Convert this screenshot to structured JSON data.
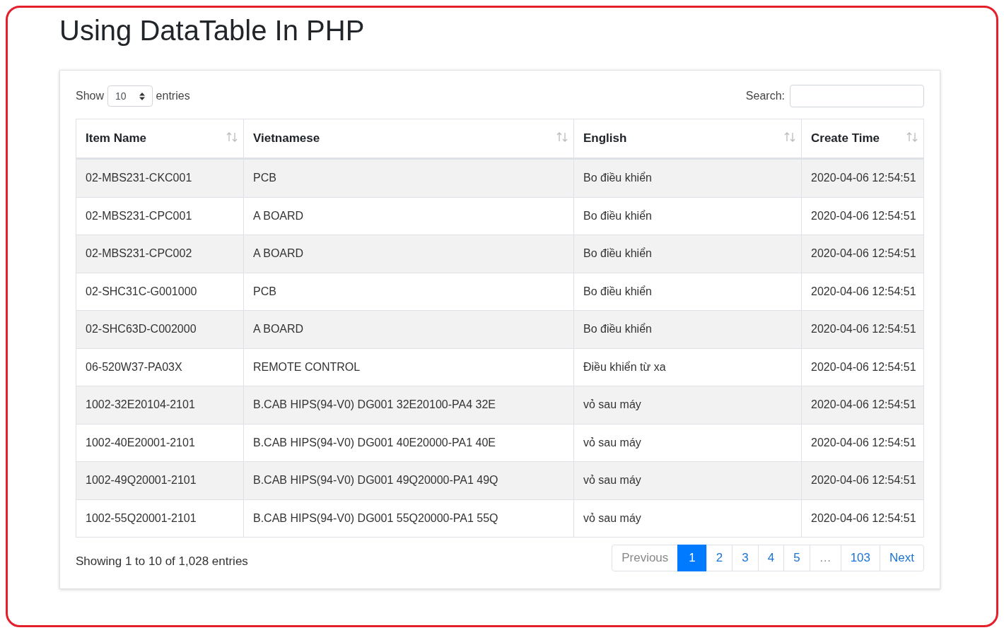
{
  "title": "Using DataTable In PHP",
  "length_menu": {
    "before": "Show",
    "value": "10",
    "after": "entries"
  },
  "search": {
    "label": "Search:"
  },
  "table": {
    "columns": [
      "Item Name",
      "Vietnamese",
      "English",
      "Create Time"
    ],
    "rows": [
      [
        "02-MBS231-CKC001",
        "PCB",
        "Bo điều khiển",
        "2020-04-06 12:54:51"
      ],
      [
        "02-MBS231-CPC001",
        "A BOARD",
        "Bo điều khiển",
        "2020-04-06 12:54:51"
      ],
      [
        "02-MBS231-CPC002",
        "A BOARD",
        "Bo điều khiển",
        "2020-04-06 12:54:51"
      ],
      [
        "02-SHC31C-G001000",
        "PCB",
        "Bo điều khiển",
        "2020-04-06 12:54:51"
      ],
      [
        "02-SHC63D-C002000",
        "A BOARD",
        "Bo điều khiển",
        "2020-04-06 12:54:51"
      ],
      [
        "06-520W37-PA03X",
        "REMOTE CONTROL",
        "Điều khiển từ xa",
        "2020-04-06 12:54:51"
      ],
      [
        "1002-32E20104-2101",
        "B.CAB HIPS(94-V0) DG001 32E20100-PA4 32E",
        "vỏ sau máy",
        "2020-04-06 12:54:51"
      ],
      [
        "1002-40E20001-2101",
        "B.CAB HIPS(94-V0) DG001 40E20000-PA1 40E",
        "vỏ sau máy",
        "2020-04-06 12:54:51"
      ],
      [
        "1002-49Q20001-2101",
        "B.CAB HIPS(94-V0) DG001 49Q20000-PA1 49Q",
        "vỏ sau máy",
        "2020-04-06 12:54:51"
      ],
      [
        "1002-55Q20001-2101",
        "B.CAB HIPS(94-V0) DG001 55Q20000-PA1 55Q",
        "vỏ sau máy",
        "2020-04-06 12:54:51"
      ]
    ]
  },
  "info": "Showing 1 to 10 of 1,028 entries",
  "pagination": [
    {
      "label": "Previous",
      "selected": false,
      "disabled": true
    },
    {
      "label": "1",
      "selected": true,
      "disabled": false
    },
    {
      "label": "2",
      "selected": false,
      "disabled": false
    },
    {
      "label": "3",
      "selected": false,
      "disabled": false
    },
    {
      "label": "4",
      "selected": false,
      "disabled": false
    },
    {
      "label": "5",
      "selected": false,
      "disabled": false
    },
    {
      "label": "…",
      "selected": false,
      "disabled": true
    },
    {
      "label": "103",
      "selected": false,
      "disabled": false
    },
    {
      "label": "Next",
      "selected": false,
      "disabled": false
    }
  ]
}
